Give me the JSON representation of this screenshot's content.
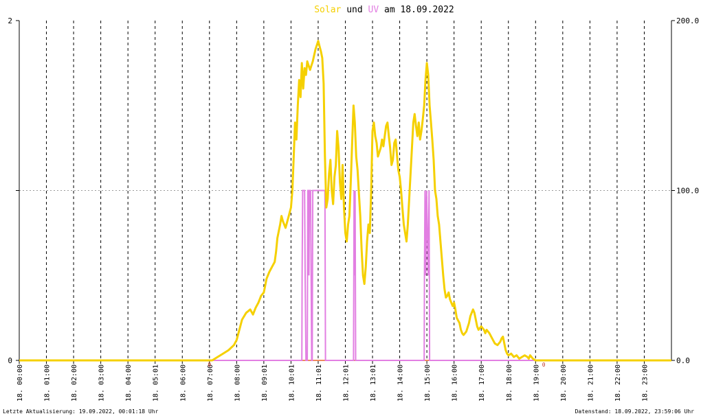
{
  "header": {
    "title_part1": "Solar",
    "title_part2": " und ",
    "title_part3": "UV",
    "title_part4": " am 18.09.2022"
  },
  "footer": {
    "left": "Letzte Aktualisierung: 19.09.2022, 00:01:18 Uhr",
    "right": "Datenstand: 18.09.2022, 23:59:06 Uhr"
  },
  "colors": {
    "solar": "#f5d000",
    "uv": "#e27fe2",
    "baseline": "#f08a5d",
    "grid": "#000000",
    "axis": "#000000"
  },
  "chart_data": {
    "type": "line",
    "title": "Solar und UV am 18.09.2022",
    "x_unit": "hours",
    "xlim": [
      0,
      24
    ],
    "left_axis": {
      "ticks": [
        0,
        1,
        2
      ],
      "tick_labels": [
        "0",
        "",
        "2"
      ],
      "ylim": [
        0,
        2
      ]
    },
    "right_axis": {
      "ticks": [
        0,
        100,
        200
      ],
      "tick_labels": [
        "0.0",
        "100.0",
        "200.0"
      ],
      "ylim": [
        0,
        200
      ]
    },
    "x_tick_labels": [
      "18. 00:00",
      "18. 01:00",
      "18. 02:00",
      "18. 03:00",
      "18. 04:00",
      "18. 05:01",
      "18. 06:00",
      "18. 07:00",
      "18. 08:00",
      "18. 09:01",
      "18. 10:01",
      "18. 11:01",
      "18. 12:01",
      "18. 13:01",
      "18. 14:00",
      "18. 15:00",
      "18. 16:00",
      "18. 17:00",
      "18. 18:00",
      "18. 19:00",
      "18. 20:00",
      "18. 21:00",
      "18. 22:00",
      "18. 23:00"
    ],
    "grid": "vertical dashed every hour, horizontal dashed at midline",
    "markers": [
      {
        "x": 7.0,
        "label": "0"
      },
      {
        "x": 19.3,
        "label": "0"
      }
    ],
    "series": [
      {
        "axis": "right",
        "points": [
          [
            0,
            0
          ],
          [
            7.1,
            0
          ],
          [
            7.3,
            2
          ],
          [
            7.5,
            4
          ],
          [
            7.7,
            6
          ],
          [
            7.9,
            9
          ],
          [
            8.0,
            12
          ],
          [
            8.1,
            18
          ],
          [
            8.2,
            24
          ],
          [
            8.35,
            28
          ],
          [
            8.5,
            30
          ],
          [
            8.6,
            27
          ],
          [
            8.7,
            31
          ],
          [
            8.8,
            34
          ],
          [
            8.9,
            38
          ],
          [
            9.0,
            40
          ],
          [
            9.1,
            48
          ],
          [
            9.2,
            52
          ],
          [
            9.3,
            55
          ],
          [
            9.4,
            58
          ],
          [
            9.45,
            64
          ],
          [
            9.5,
            72
          ],
          [
            9.6,
            80
          ],
          [
            9.65,
            85
          ],
          [
            9.7,
            82
          ],
          [
            9.8,
            78
          ],
          [
            9.9,
            84
          ],
          [
            10.0,
            90
          ],
          [
            10.05,
            100
          ],
          [
            10.1,
            120
          ],
          [
            10.15,
            140
          ],
          [
            10.2,
            130
          ],
          [
            10.25,
            150
          ],
          [
            10.3,
            165
          ],
          [
            10.35,
            155
          ],
          [
            10.4,
            175
          ],
          [
            10.45,
            160
          ],
          [
            10.5,
            172
          ],
          [
            10.55,
            168
          ],
          [
            10.6,
            176
          ],
          [
            10.7,
            171
          ],
          [
            10.8,
            176
          ],
          [
            10.9,
            183
          ],
          [
            11.0,
            188
          ],
          [
            11.05,
            185
          ],
          [
            11.1,
            182
          ],
          [
            11.15,
            178
          ],
          [
            11.2,
            163
          ],
          [
            11.25,
            120
          ],
          [
            11.3,
            90
          ],
          [
            11.35,
            95
          ],
          [
            11.4,
            110
          ],
          [
            11.45,
            118
          ],
          [
            11.5,
            100
          ],
          [
            11.55,
            92
          ],
          [
            11.6,
            108
          ],
          [
            11.65,
            115
          ],
          [
            11.7,
            135
          ],
          [
            11.75,
            125
          ],
          [
            11.8,
            105
          ],
          [
            11.85,
            95
          ],
          [
            11.9,
            115
          ],
          [
            11.95,
            90
          ],
          [
            12.0,
            75
          ],
          [
            12.05,
            70
          ],
          [
            12.1,
            80
          ],
          [
            12.15,
            85
          ],
          [
            12.2,
            105
          ],
          [
            12.25,
            128
          ],
          [
            12.3,
            150
          ],
          [
            12.35,
            140
          ],
          [
            12.4,
            120
          ],
          [
            12.45,
            112
          ],
          [
            12.5,
            98
          ],
          [
            12.55,
            85
          ],
          [
            12.6,
            65
          ],
          [
            12.65,
            50
          ],
          [
            12.7,
            45
          ],
          [
            12.75,
            55
          ],
          [
            12.8,
            70
          ],
          [
            12.85,
            80
          ],
          [
            12.9,
            75
          ],
          [
            12.95,
            100
          ],
          [
            13.0,
            135
          ],
          [
            13.05,
            140
          ],
          [
            13.1,
            132
          ],
          [
            13.15,
            128
          ],
          [
            13.2,
            120
          ],
          [
            13.3,
            125
          ],
          [
            13.35,
            130
          ],
          [
            13.4,
            126
          ],
          [
            13.45,
            132
          ],
          [
            13.5,
            138
          ],
          [
            13.55,
            140
          ],
          [
            13.6,
            132
          ],
          [
            13.65,
            125
          ],
          [
            13.7,
            115
          ],
          [
            13.75,
            118
          ],
          [
            13.8,
            128
          ],
          [
            13.85,
            130
          ],
          [
            13.9,
            121
          ],
          [
            13.95,
            112
          ],
          [
            14.0,
            108
          ],
          [
            14.05,
            100
          ],
          [
            14.1,
            90
          ],
          [
            14.15,
            80
          ],
          [
            14.2,
            75
          ],
          [
            14.25,
            70
          ],
          [
            14.3,
            80
          ],
          [
            14.35,
            95
          ],
          [
            14.4,
            110
          ],
          [
            14.45,
            125
          ],
          [
            14.5,
            140
          ],
          [
            14.55,
            145
          ],
          [
            14.6,
            138
          ],
          [
            14.65,
            132
          ],
          [
            14.7,
            140
          ],
          [
            14.75,
            130
          ],
          [
            14.8,
            135
          ],
          [
            14.85,
            142
          ],
          [
            14.9,
            150
          ],
          [
            14.95,
            165
          ],
          [
            15.0,
            175
          ],
          [
            15.05,
            168
          ],
          [
            15.1,
            150
          ],
          [
            15.15,
            140
          ],
          [
            15.2,
            130
          ],
          [
            15.25,
            118
          ],
          [
            15.3,
            100
          ],
          [
            15.35,
            95
          ],
          [
            15.4,
            85
          ],
          [
            15.45,
            80
          ],
          [
            15.5,
            70
          ],
          [
            15.55,
            60
          ],
          [
            15.6,
            50
          ],
          [
            15.65,
            42
          ],
          [
            15.7,
            37
          ],
          [
            15.75,
            38
          ],
          [
            15.8,
            40
          ],
          [
            15.85,
            36
          ],
          [
            15.9,
            34
          ],
          [
            15.95,
            32
          ],
          [
            16.0,
            34
          ],
          [
            16.05,
            30
          ],
          [
            16.1,
            25
          ],
          [
            16.2,
            22
          ],
          [
            16.25,
            18
          ],
          [
            16.3,
            16
          ],
          [
            16.35,
            15
          ],
          [
            16.45,
            17
          ],
          [
            16.55,
            22
          ],
          [
            16.6,
            26
          ],
          [
            16.7,
            30
          ],
          [
            16.75,
            28
          ],
          [
            16.8,
            24
          ],
          [
            16.85,
            20
          ],
          [
            16.9,
            18
          ],
          [
            17.0,
            20
          ],
          [
            17.1,
            18
          ],
          [
            17.15,
            16
          ],
          [
            17.2,
            18
          ],
          [
            17.3,
            16
          ],
          [
            17.4,
            13
          ],
          [
            17.5,
            10
          ],
          [
            17.6,
            9
          ],
          [
            17.7,
            11
          ],
          [
            17.75,
            13
          ],
          [
            17.8,
            14
          ],
          [
            17.85,
            10
          ],
          [
            17.9,
            6
          ],
          [
            17.95,
            4
          ],
          [
            18.0,
            3
          ],
          [
            18.1,
            4
          ],
          [
            18.2,
            2
          ],
          [
            18.3,
            3
          ],
          [
            18.4,
            1
          ],
          [
            18.5,
            2
          ],
          [
            18.6,
            3
          ],
          [
            18.7,
            2
          ],
          [
            18.75,
            1
          ],
          [
            18.8,
            3
          ],
          [
            18.9,
            1
          ],
          [
            19.0,
            0
          ],
          [
            24,
            0
          ]
        ]
      },
      {
        "axis": "left",
        "points": [
          [
            0,
            0
          ],
          [
            10.4,
            0
          ],
          [
            10.41,
            0.5
          ],
          [
            10.43,
            1
          ],
          [
            10.5,
            1
          ],
          [
            10.52,
            0.5
          ],
          [
            10.55,
            0
          ],
          [
            10.6,
            0
          ],
          [
            10.62,
            1
          ],
          [
            10.65,
            1
          ],
          [
            10.66,
            0.5
          ],
          [
            10.68,
            1
          ],
          [
            10.72,
            1
          ],
          [
            10.74,
            0.5
          ],
          [
            10.76,
            0
          ],
          [
            10.78,
            0
          ],
          [
            10.8,
            1
          ],
          [
            11.25,
            1
          ],
          [
            11.27,
            0
          ],
          [
            12.3,
            0
          ],
          [
            12.32,
            1
          ],
          [
            12.34,
            0.5
          ],
          [
            12.36,
            1
          ],
          [
            12.38,
            0
          ],
          [
            14.9,
            0
          ],
          [
            14.91,
            0.5
          ],
          [
            14.93,
            1
          ],
          [
            14.96,
            0.5
          ],
          [
            14.99,
            1
          ],
          [
            15.05,
            0.5
          ],
          [
            15.08,
            1
          ],
          [
            15.1,
            0
          ],
          [
            24,
            0
          ]
        ]
      }
    ]
  }
}
